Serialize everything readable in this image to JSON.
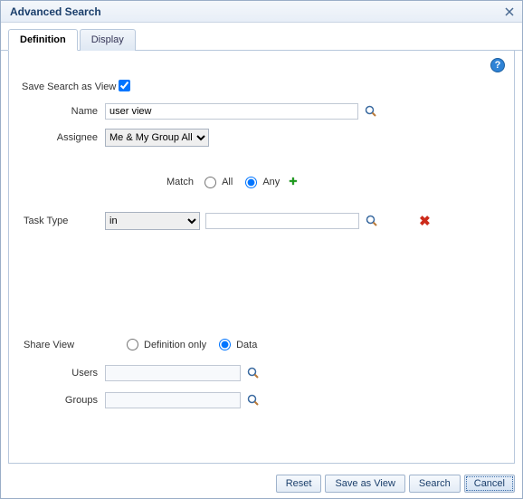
{
  "dialog": {
    "title": "Advanced Search",
    "close_tooltip": "Close"
  },
  "tabs": [
    {
      "label": "Definition",
      "active": true
    },
    {
      "label": "Display",
      "active": false
    }
  ],
  "help": {
    "tooltip": "Help"
  },
  "form": {
    "save_as_view_label": "Save Search as View",
    "save_as_view_checked": true,
    "name_label": "Name",
    "name_value": "user view",
    "assignee_label": "Assignee",
    "assignee_value": "Me & My Group All",
    "match_label": "Match",
    "match_options": {
      "all": "All",
      "any": "Any"
    },
    "match_selected": "any",
    "task_type_label": "Task Type",
    "task_type_operator": "in",
    "task_type_value": "",
    "share_view_label": "Share View",
    "share_options": {
      "definition": "Definition only",
      "data": "Data"
    },
    "share_selected": "data",
    "users_label": "Users",
    "users_value": "",
    "groups_label": "Groups",
    "groups_value": ""
  },
  "icons": {
    "lookup_tooltip": "Browse",
    "add_tooltip": "Add Condition",
    "remove_tooltip": "Remove Condition"
  },
  "buttons": {
    "reset": "Reset",
    "save_as_view": "Save as View",
    "search": "Search",
    "cancel": "Cancel"
  }
}
